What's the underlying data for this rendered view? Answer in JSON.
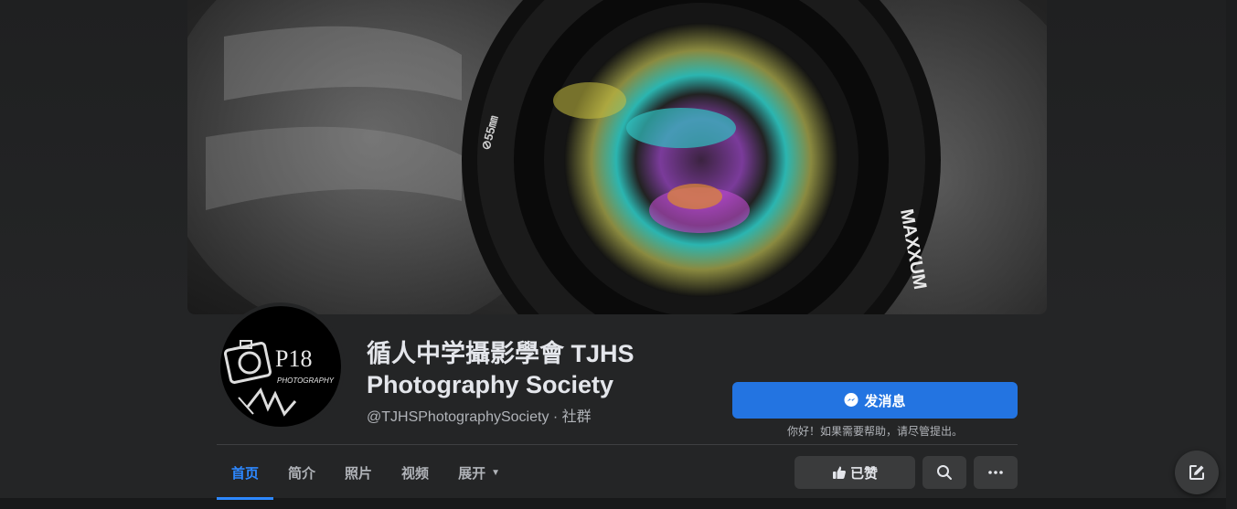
{
  "page": {
    "name": "循人中学攝影學會 TJHS Photography Society",
    "handle": "@TJHSPhotographySociety",
    "separator": " · ",
    "category": "社群"
  },
  "cover": {
    "lens_text": "MAXXUM",
    "lens_ring_text": "⊘55㎜"
  },
  "avatar": {
    "logo_text": "P18",
    "logo_subtext": "PHOTOGRAPHY"
  },
  "actions": {
    "message_label": "发消息",
    "message_note": "你好！如果需要帮助，请尽管提出。",
    "like_label": "已赞"
  },
  "tabs": [
    {
      "label": "首页",
      "active": true
    },
    {
      "label": "简介",
      "active": false
    },
    {
      "label": "照片",
      "active": false
    },
    {
      "label": "视频",
      "active": false
    },
    {
      "label": "展开",
      "active": false
    }
  ],
  "icons": {
    "message": "messenger-icon",
    "like": "thumbs-up-icon",
    "search": "search-icon",
    "more": "more-icon",
    "expand": "caret-down-icon",
    "compose": "compose-icon"
  },
  "colors": {
    "accent": "#2374e1",
    "active_tab": "#2d88ff",
    "background": "#18191a",
    "surface": "#242526",
    "button": "#3a3b3c"
  }
}
